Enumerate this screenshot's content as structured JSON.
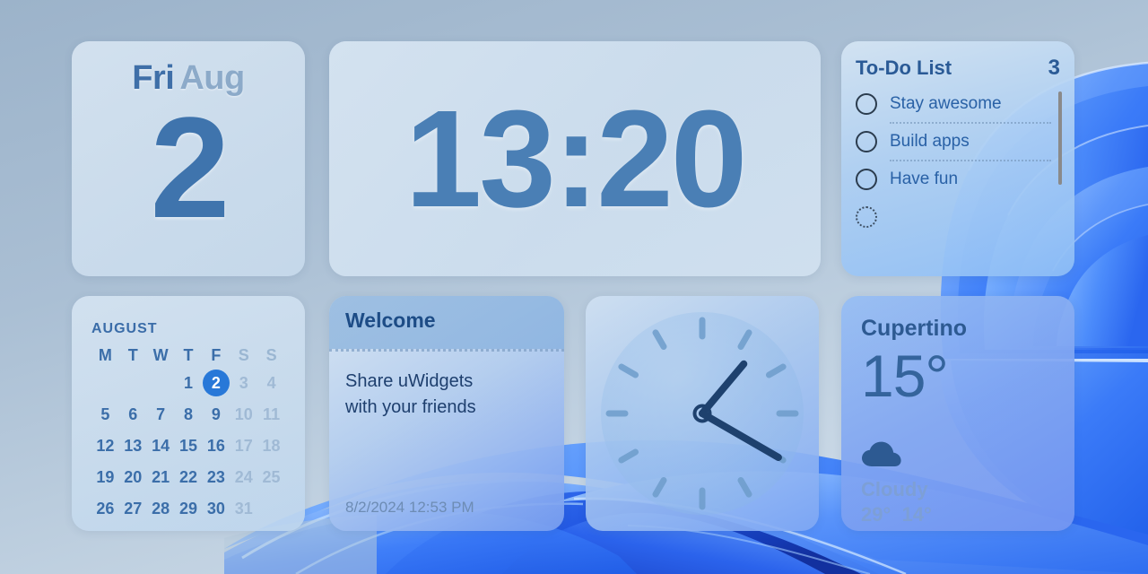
{
  "wallpaper": {
    "name": "windows-11-bloom",
    "base_color": "#a8bdd2",
    "ribbon_colors": [
      "#2f6bf5",
      "#4a8cfb",
      "#6fa6fc",
      "#1a4fd8",
      "#8fc2fe",
      "#1536b8"
    ]
  },
  "date_widget": {
    "weekday": "Fri",
    "month": "Aug",
    "day": "2"
  },
  "digital_clock": {
    "time": "13:20",
    "color": "#4a7fb5"
  },
  "todo": {
    "title": "To-Do List",
    "count": "3",
    "items": [
      {
        "label": "Stay awesome",
        "checked": false
      },
      {
        "label": "Build apps",
        "checked": false
      },
      {
        "label": "Have fun",
        "checked": false
      }
    ],
    "add_label": "add-task"
  },
  "calendar": {
    "month": "AUGUST",
    "dow": [
      "M",
      "T",
      "W",
      "T",
      "F",
      "S",
      "S"
    ],
    "today": "2",
    "weeks": [
      [
        "",
        "",
        "",
        "1",
        "2",
        "3",
        "4"
      ],
      [
        "5",
        "6",
        "7",
        "8",
        "9",
        "10",
        "11"
      ],
      [
        "12",
        "13",
        "14",
        "15",
        "16",
        "17",
        "18"
      ],
      [
        "19",
        "20",
        "21",
        "22",
        "23",
        "24",
        "25"
      ],
      [
        "26",
        "27",
        "28",
        "29",
        "30",
        "31",
        ""
      ]
    ],
    "highlight_color": "#2878d8"
  },
  "welcome_note": {
    "title": "Welcome",
    "body_line1": "Share uWidgets",
    "body_line2": "with your friends",
    "timestamp": "8/2/2024 12:53 PM"
  },
  "analog_clock": {
    "hour_angle_deg": 40,
    "minute_angle_deg": 120,
    "tick_count": "12",
    "hand_color": "#1e416e",
    "tick_color": "#6e9dcb"
  },
  "weather": {
    "city": "Cupertino",
    "temperature": "15°",
    "condition": "Cloudy",
    "high": "29°",
    "low": "14°",
    "icon": "cloud-icon"
  }
}
